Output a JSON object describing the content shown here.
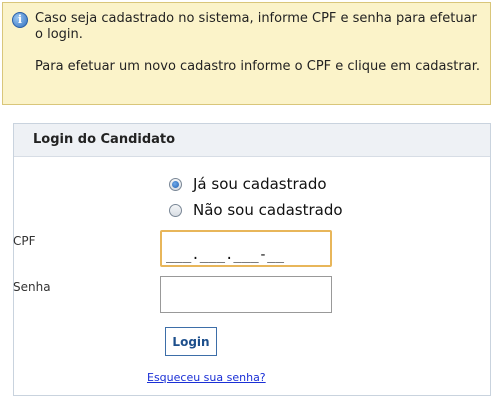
{
  "info": {
    "line1": "Caso seja cadastrado no sistema, informe CPF e senha para efetuar o login.",
    "line2": "Para efetuar um novo cadastro informe o CPF e clique em cadastrar."
  },
  "login": {
    "title": "Login do Candidato",
    "radio_registered": "Já sou cadastrado",
    "radio_not_registered": "Não sou cadastrado",
    "cpf_label": "CPF",
    "cpf_value": "___.___.___-__",
    "senha_label": "Senha",
    "senha_value": "",
    "login_button": "Login",
    "forgot_link": "Esqueceu sua senha?"
  }
}
